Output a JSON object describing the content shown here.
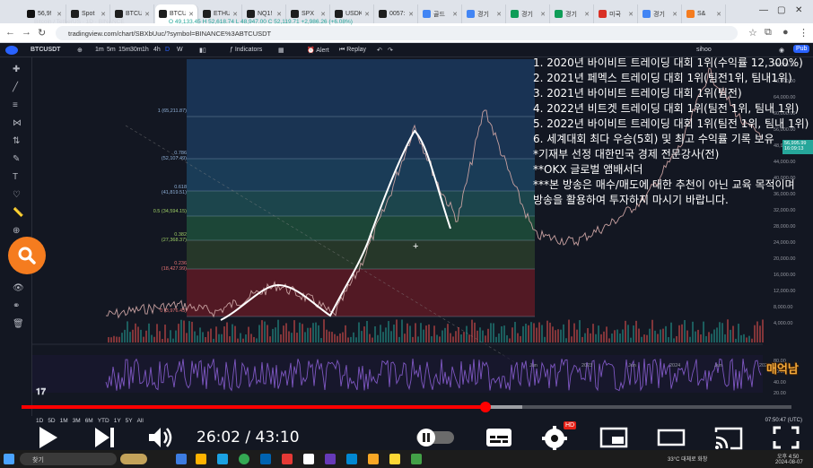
{
  "browser": {
    "tabs": [
      {
        "label": "56,9!",
        "color": "#111111"
      },
      {
        "label": "Spot",
        "color": "#1e1e1e"
      },
      {
        "label": "BTCU",
        "color": "#1e1e1e"
      },
      {
        "label": "BTCU",
        "color": "#1e1e1e"
      },
      {
        "label": "ETHU",
        "color": "#1e1e1e"
      },
      {
        "label": "NQ1!",
        "color": "#1e1e1e"
      },
      {
        "label": "SPX",
        "color": "#1e1e1e"
      },
      {
        "label": "USDK",
        "color": "#1e1e1e"
      },
      {
        "label": "0057:",
        "color": "#1e1e1e"
      },
      {
        "label": "골드",
        "color": "#4285f4"
      },
      {
        "label": "경기",
        "color": "#4285f4"
      },
      {
        "label": "경기",
        "color": "#0f9d58"
      },
      {
        "label": "경기",
        "color": "#0f9d58"
      },
      {
        "label": "미국",
        "color": "#d93025"
      },
      {
        "label": "경기",
        "color": "#4285f4"
      },
      {
        "label": "S&",
        "color": "#f57c1f"
      }
    ],
    "url": "tradingview.com/chart/SBXbUuc/?symbol=BINANCE%3ABTCUSDT"
  },
  "tv": {
    "symbol_chip": "BTCUSDT",
    "intervals": [
      "1m",
      "5m",
      "15m",
      "30m",
      "1h",
      "4h",
      "D",
      "W"
    ],
    "indicators_label": "Indicators",
    "alert_label": "Alert",
    "replay_label": "Replay",
    "user_label": "sihoo",
    "publish_label": "Pub",
    "legend_title": "Bitcoin / TetherUS · 1D · BINANCE",
    "legend_ohlc": "O 49,133.45  H 52,618.74  L 48,947.00  C 52,119.71  +2,986.26 (+6.08%)",
    "fib_levels": [
      {
        "label": "1 (65,211.87)"
      },
      {
        "label": "0.786 (52,107.49)"
      },
      {
        "label": "0.618 (41,819.51)"
      },
      {
        "label": "0.5 (34,594.15)"
      },
      {
        "label": "0.382 (27,368.37)"
      },
      {
        "label": "0.236 (18,427.99)"
      },
      {
        "label": "0 (3,976.43)"
      }
    ],
    "price_axis": [
      "72,000.00",
      "68,000.00",
      "64,000.00",
      "60,000.00",
      "56,000.00",
      "48,947.00",
      "44,000.00",
      "40,000.00",
      "36,000.00",
      "32,000.00",
      "28,000.00",
      "24,000.00",
      "20,000.00",
      "16,000.00",
      "12,000.00",
      "8,000.00",
      "4,000.00",
      "80.00",
      "60.00",
      "40.00",
      "20.00"
    ],
    "price_current": "56,995.99",
    "price_current_time": "16:09:13",
    "x_axis": [
      "Jun",
      "2023",
      "Jun",
      "2024",
      "Jun",
      "2025"
    ],
    "ranges": [
      "1D",
      "5D",
      "1M",
      "3M",
      "6M",
      "YTD",
      "1Y",
      "5Y",
      "All"
    ],
    "utc_time": "07:50:47 (UTC)",
    "screener_label": "Screener",
    "strategy_label": "Stra"
  },
  "overlay_lines": [
    "1. 2020년 바이비트 트레이딩 대회 1위(수익률 12,300%)",
    "2. 2021년 페멕스 트레이딩 대회 1위(팀전1위, 팀내1위)",
    "3. 2021년 바이비트 트레이딩 대회 1위(팀전)",
    "4. 2022년 비트겟 트레이딩 대회 1위(팀전 1위, 팀내 1위)",
    "5. 2022년 바이비트 트레이딩 대회 1위(팀전 1위, 팀내 1위)",
    "6. 세계대회 최다 우승(5회) 및 최고 수익률 기록 보유",
    "*기재부 선정 대한민국 경제 전문강사(전)",
    "**OKX 글로벌 앰배서더",
    "***본 방송은 매수/매도에 대한 추천이 아닌 교육 목적이며",
    "방송을 활용하여 투자하지 마시기 바랍니다."
  ],
  "watermark": "매억남",
  "player": {
    "current_time": "26:02",
    "separator": " / ",
    "duration": "43:10",
    "played_fraction": 0.603,
    "buffered_fraction": 0.65,
    "quality_badge": "HD",
    "accent": "#ff0000"
  },
  "taskbar": {
    "search_placeholder": "찾기",
    "weather": "33°C  대체로 화창",
    "time": "오후 4:50",
    "date": "2024-08-07"
  }
}
